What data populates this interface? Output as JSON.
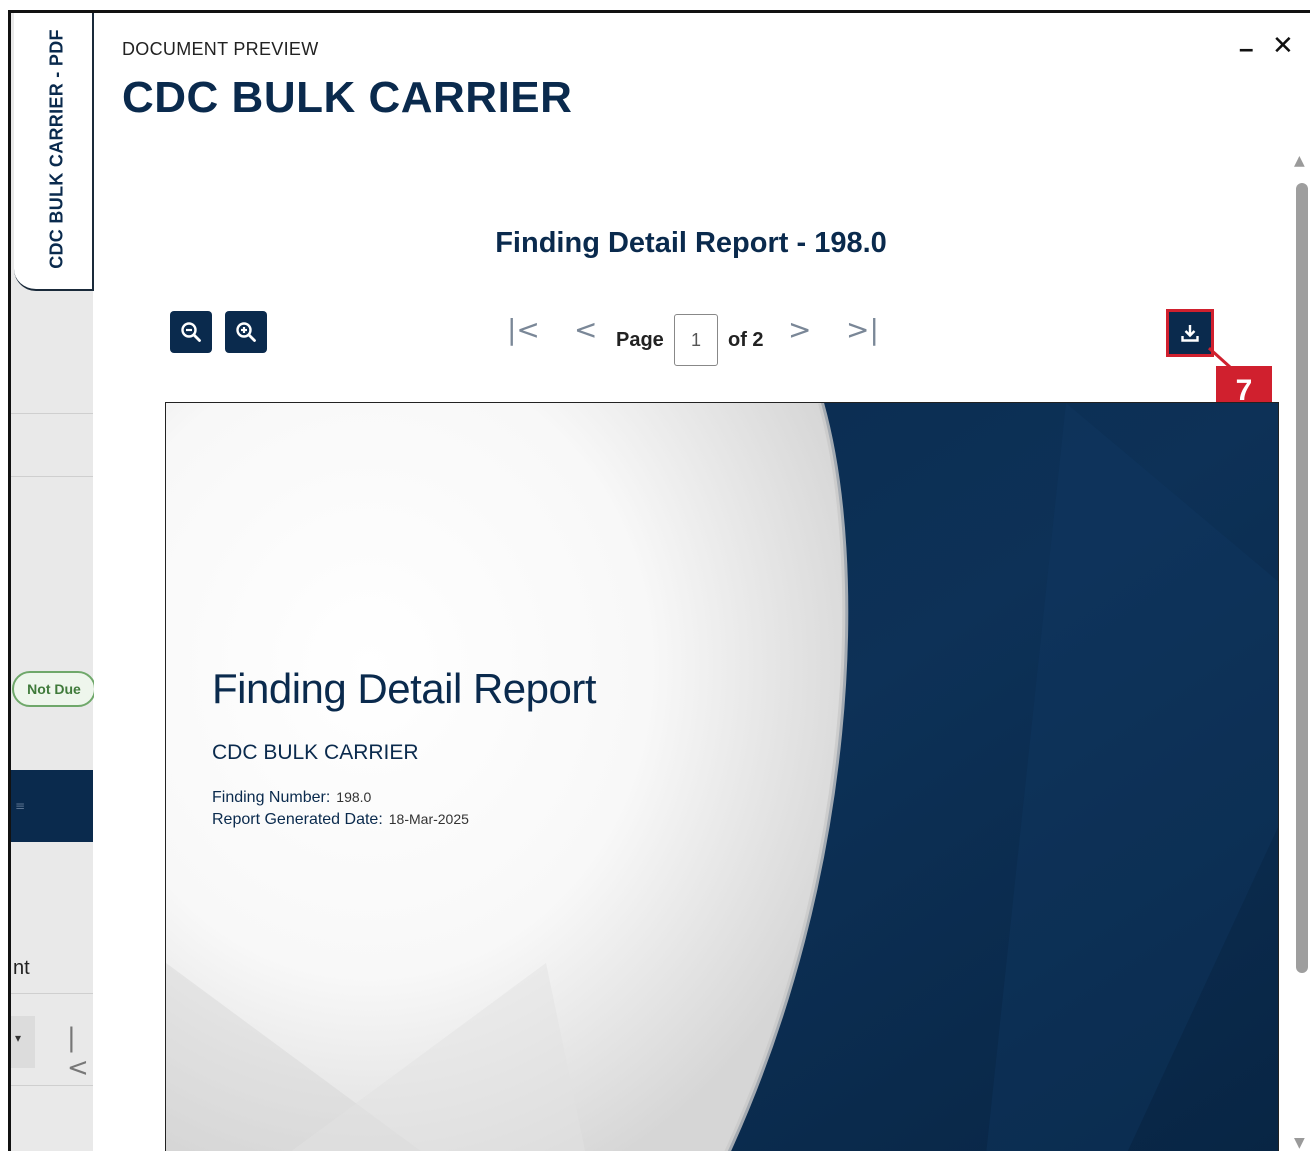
{
  "side_tab": {
    "label": "CDC BULK CARRIER - PDF"
  },
  "background": {
    "status_badge": "Not Due",
    "partial_text": "nt"
  },
  "header": {
    "label": "DOCUMENT PREVIEW",
    "title": "CDC BULK CARRIER"
  },
  "window_controls": {
    "minimize": "–",
    "close": "✕"
  },
  "report": {
    "heading": "Finding Detail Report - 198.0"
  },
  "toolbar": {
    "zoom_out_icon": "zoom-out-icon",
    "zoom_in_icon": "zoom-in-icon",
    "first_glyph": "|<",
    "prev_glyph": "<",
    "page_label": "Page",
    "page_value": "1",
    "of_label": "of 2",
    "next_glyph": ">",
    "last_glyph": ">|",
    "download_icon": "download-icon"
  },
  "callout": {
    "number": "7",
    "color": "#d0202e"
  },
  "document_page": {
    "title": "Finding Detail Report",
    "vessel": "CDC BULK CARRIER",
    "finding_number_label": "Finding Number:",
    "finding_number_value": "198.0",
    "date_label": "Report Generated Date:",
    "date_value": "18-Mar-2025"
  },
  "colors": {
    "navy": "#0a2a4d",
    "accent_red": "#d0202e",
    "badge_green": "#3f7a3a"
  }
}
